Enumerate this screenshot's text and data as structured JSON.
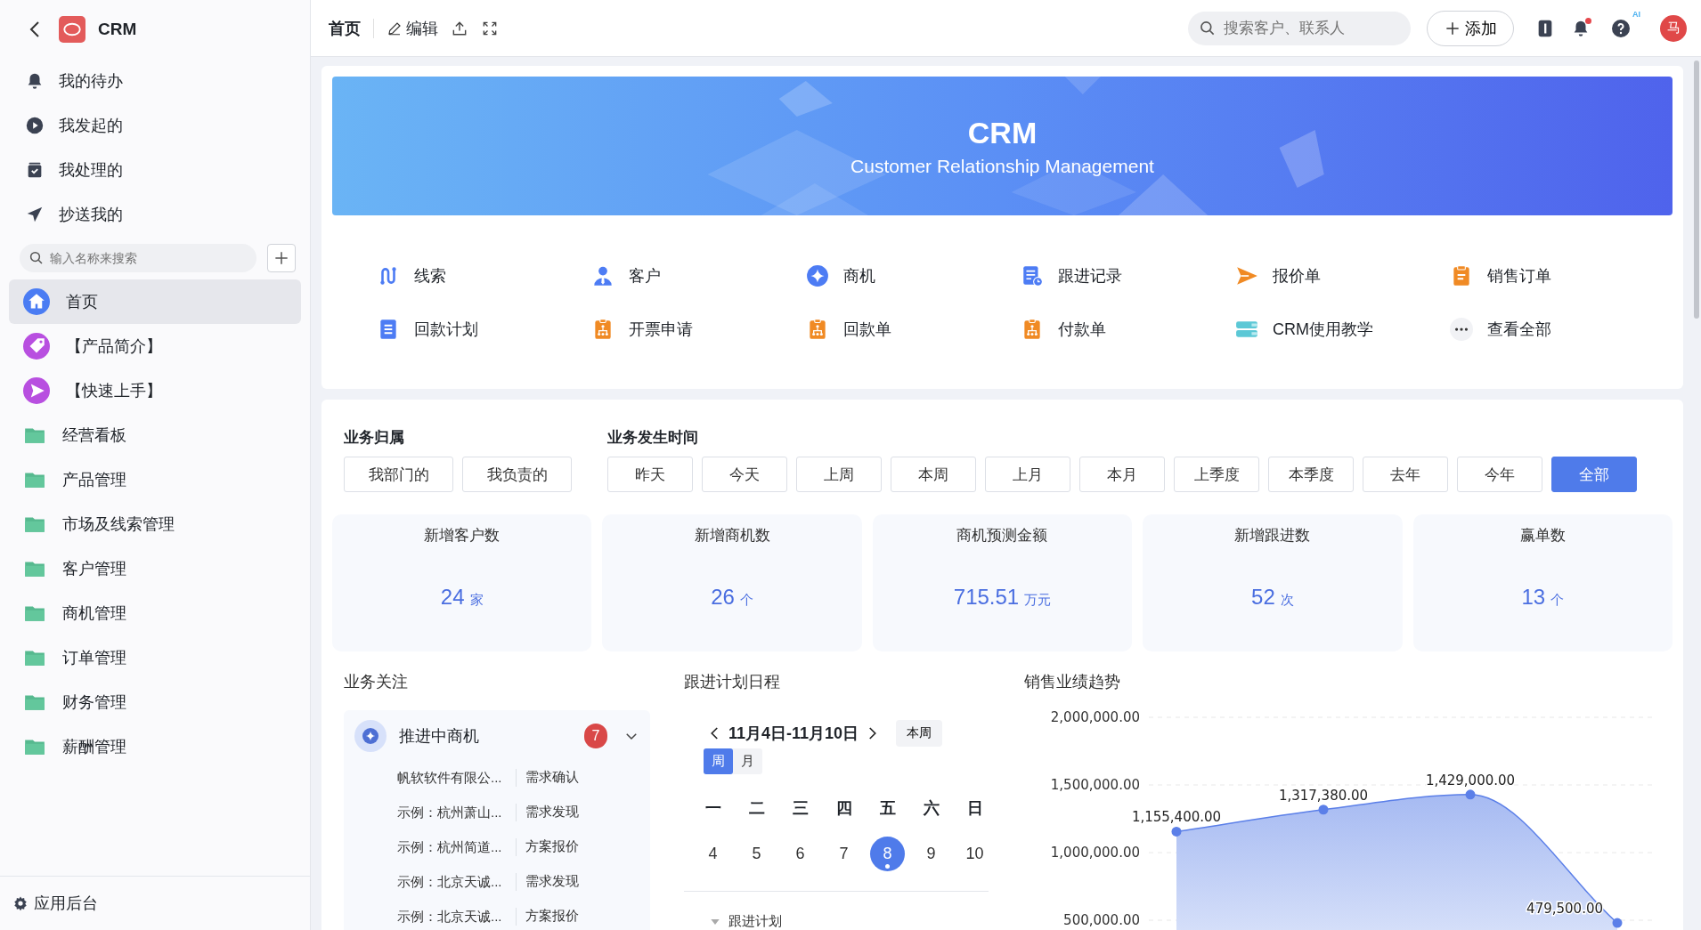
{
  "sidebar": {
    "app_name": "CRM",
    "shortcuts": [
      {
        "label": "我的待办",
        "kind": "bell"
      },
      {
        "label": "我发起的",
        "kind": "play"
      },
      {
        "label": "我处理的",
        "kind": "inbox"
      },
      {
        "label": "抄送我的",
        "kind": "plane"
      }
    ],
    "search": {
      "placeholder": "输入名称来搜索"
    },
    "nav": [
      {
        "label": "首页",
        "kind": "home",
        "selected": true
      },
      {
        "label": "【产品简介】",
        "kind": "tag",
        "selected": false
      },
      {
        "label": "【快速上手】",
        "kind": "send",
        "selected": false
      },
      {
        "label": "经营看板",
        "kind": "folder",
        "selected": false
      },
      {
        "label": "产品管理",
        "kind": "folder",
        "selected": false
      },
      {
        "label": "市场及线索管理",
        "kind": "folder",
        "selected": false
      },
      {
        "label": "客户管理",
        "kind": "folder",
        "selected": false
      },
      {
        "label": "商机管理",
        "kind": "folder",
        "selected": false
      },
      {
        "label": "订单管理",
        "kind": "folder",
        "selected": false
      },
      {
        "label": "财务管理",
        "kind": "folder",
        "selected": false
      },
      {
        "label": "薪酬管理",
        "kind": "folder",
        "selected": false
      }
    ],
    "footer": "应用后台"
  },
  "topbar": {
    "tabs": [
      {
        "label": "首页",
        "selected": true
      }
    ],
    "edit_label": "编辑",
    "search": {
      "placeholder": "搜索客户、联系人"
    },
    "add_label": "添加",
    "notifications_unread": true,
    "ai_badge": "AI",
    "avatar": "马"
  },
  "banner": {
    "title": "CRM",
    "subtitle": "Customer Relationship Management"
  },
  "quick_links": [
    {
      "label": "线索",
      "kind": "lead"
    },
    {
      "label": "客户",
      "kind": "person"
    },
    {
      "label": "商机",
      "kind": "star"
    },
    {
      "label": "跟进记录",
      "kind": "record"
    },
    {
      "label": "报价单",
      "kind": "plane"
    },
    {
      "label": "销售订单",
      "kind": "clipboard"
    },
    {
      "label": "回款计划",
      "kind": "doc"
    },
    {
      "label": "开票申请",
      "kind": "org"
    },
    {
      "label": "回款单",
      "kind": "org"
    },
    {
      "label": "付款单",
      "kind": "org"
    },
    {
      "label": "CRM使用教学",
      "kind": "book"
    },
    {
      "label": "查看全部",
      "kind": "more"
    }
  ],
  "filters": [
    {
      "title": "业务归属",
      "options": [
        {
          "label": "我部门的",
          "selected": false
        },
        {
          "label": "我负责的",
          "selected": false
        }
      ]
    },
    {
      "title": "业务发生时间",
      "options": [
        {
          "label": "昨天",
          "selected": false
        },
        {
          "label": "今天",
          "selected": false
        },
        {
          "label": "上周",
          "selected": false
        },
        {
          "label": "本周",
          "selected": false
        },
        {
          "label": "上月",
          "selected": false
        },
        {
          "label": "本月",
          "selected": false
        },
        {
          "label": "上季度",
          "selected": false
        },
        {
          "label": "本季度",
          "selected": false
        },
        {
          "label": "去年",
          "selected": false
        },
        {
          "label": "今年",
          "selected": false
        },
        {
          "label": "全部",
          "selected": true
        }
      ]
    }
  ],
  "stats": [
    {
      "label": "新增客户数",
      "value": "24",
      "unit": "家"
    },
    {
      "label": "新增商机数",
      "value": "26",
      "unit": "个"
    },
    {
      "label": "商机预测金额",
      "value": "715.51",
      "unit": "万元"
    },
    {
      "label": "新增跟进数",
      "value": "52",
      "unit": "次"
    },
    {
      "label": "赢单数",
      "value": "13",
      "unit": "个"
    }
  ],
  "focus": {
    "title": "业务关注",
    "group": {
      "label": "推进中商机",
      "count": "7",
      "expanded": true,
      "rows": [
        {
          "name": "帆软软件有限公...",
          "stage": "需求确认"
        },
        {
          "name": "示例：杭州萧山...",
          "stage": "需求发现"
        },
        {
          "name": "示例：杭州简道...",
          "stage": "方案报价"
        },
        {
          "name": "示例：北京天诚...",
          "stage": "需求发现"
        },
        {
          "name": "示例：北京天诚...",
          "stage": "方案报价"
        }
      ]
    }
  },
  "calendar": {
    "title": "跟进计划日程",
    "range": "11月4日-11月10日",
    "this_week": "本周",
    "views": [
      {
        "label": "周",
        "selected": true
      },
      {
        "label": "月",
        "selected": false
      }
    ],
    "weekdays": [
      "一",
      "二",
      "三",
      "四",
      "五",
      "六",
      "日"
    ],
    "days": [
      {
        "label": "4",
        "selected": false,
        "has_event": false
      },
      {
        "label": "5",
        "selected": false,
        "has_event": false
      },
      {
        "label": "6",
        "selected": false,
        "has_event": false
      },
      {
        "label": "7",
        "selected": false,
        "has_event": false
      },
      {
        "label": "8",
        "selected": true,
        "has_event": true
      },
      {
        "label": "9",
        "selected": false,
        "has_event": false
      },
      {
        "label": "10",
        "selected": false,
        "has_event": false
      }
    ],
    "section": "跟进计划",
    "section_expanded": true
  },
  "sales": {
    "title": "销售业绩趋势",
    "chart_data": {
      "type": "area",
      "values": [
        1155400,
        1317380,
        1429000,
        479500
      ],
      "value_labels": [
        "1,155,400.00",
        "1,317,380.00",
        "1,429,000.00",
        "479,500.00"
      ],
      "ylim": [
        0,
        2000000
      ],
      "grid": true,
      "yticks": [
        {
          "value": 500000,
          "label": "500,000.00"
        },
        {
          "value": 1000000,
          "label": "1,000,000.00"
        },
        {
          "value": 1500000,
          "label": "1,500,000.00"
        },
        {
          "value": 2000000,
          "label": "2,000,000.00"
        }
      ],
      "data_labels": true
    }
  }
}
